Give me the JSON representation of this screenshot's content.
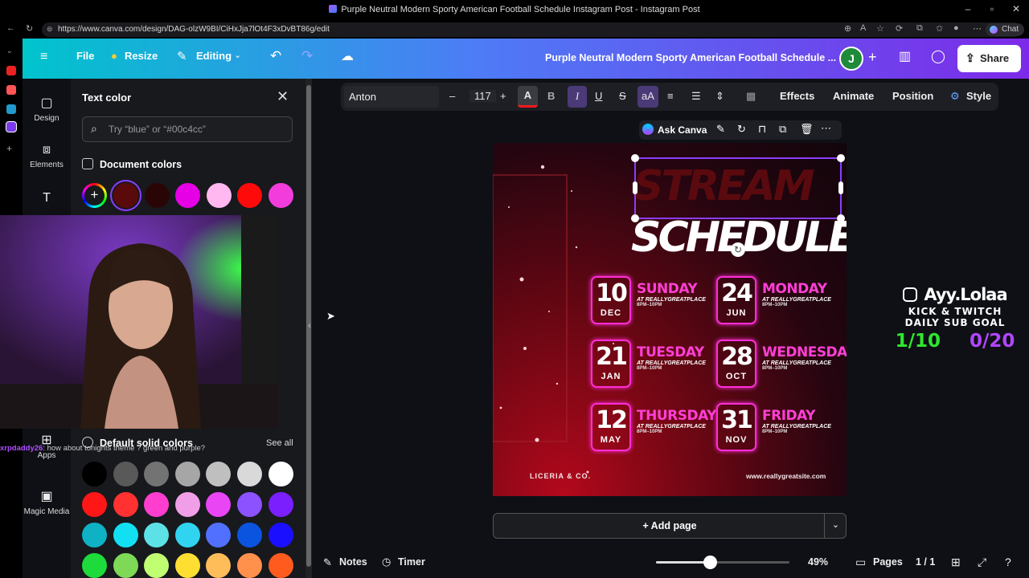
{
  "browser": {
    "window_title": "Purple Neutral Modern Sporty American Football Schedule Instagram Post - Instagram Post",
    "url": "https://www.canva.com/design/DAG-olzW9BI/CiHxJja7lOt4F3xDvBT86g/edit",
    "chat_label": "Chat"
  },
  "header": {
    "file": "File",
    "resize": "Resize",
    "editing": "Editing",
    "doc_title": "Purple Neutral Modern Sporty American Football Schedule ...",
    "avatar_initial": "J",
    "share": "Share"
  },
  "rail": {
    "design": "Design",
    "elements": "Elements",
    "apps": "Apps",
    "magic_media": "Magic Media"
  },
  "panel": {
    "title": "Text color",
    "search_placeholder": "Try “blue” or “#00c4cc”",
    "document_colors": "Document colors",
    "default_solid": "Default solid colors",
    "see_all": "See all",
    "doc_swatches": [
      "#5a0a0a",
      "#2a0505",
      "#e600e6",
      "#ffb8f0",
      "#ff0a0a",
      "#f23ddc"
    ],
    "default_swatches": [
      [
        "#000000",
        "#595959",
        "#737373",
        "#a6a6a6",
        "#bfbfbf",
        "#d9d9d9",
        "#ffffff"
      ],
      [
        "#ff1616",
        "#ff3131",
        "#ff3ecf",
        "#f19ee8",
        "#e945f5",
        "#8c52ff",
        "#7b1fff"
      ],
      [
        "#0fb1c5",
        "#12e0f2",
        "#5ce1e6",
        "#30d3f0",
        "#5170ff",
        "#0b54e0",
        "#1a10ff"
      ],
      [
        "#1ddb3b",
        "#7ed957",
        "#c1ff72",
        "#ffde32",
        "#ffbd59",
        "#ff914d",
        "#ff5b1f"
      ]
    ]
  },
  "chat": {
    "user": "xrpdaddy26",
    "message": ": how about tonights theme ? green and purple?"
  },
  "toolbar": {
    "font": "Anton",
    "minus": "–",
    "size": "117",
    "plus": "+",
    "effects": "Effects",
    "animate": "Animate",
    "position": "Position",
    "style": "Style",
    "ask_canva": "Ask Canva"
  },
  "design": {
    "stream": "STREAM",
    "schedule": "SCHEDULE",
    "items": [
      {
        "num": "10",
        "mon": "DEC",
        "day": "SUNDAY",
        "sub": "AT REALLYGREATPLACE",
        "time": "8PM–10PM"
      },
      {
        "num": "24",
        "mon": "JUN",
        "day": "MONDAY",
        "sub": "AT REALLYGREATPLACE",
        "time": "8PM–10PM"
      },
      {
        "num": "21",
        "mon": "JAN",
        "day": "TUESDAY",
        "sub": "AT REALLYGREATPLACE",
        "time": "8PM–10PM"
      },
      {
        "num": "28",
        "mon": "OCT",
        "day": "WEDNESDAY",
        "sub": "AT REALLYGREATPLACE",
        "time": "8PM–10PM"
      },
      {
        "num": "12",
        "mon": "MAY",
        "day": "THURSDAY",
        "sub": "AT REALLYGREATPLACE",
        "time": "8PM–10PM"
      },
      {
        "num": "31",
        "mon": "NOV",
        "day": "FRIDAY",
        "sub": "AT REALLYGREATPLACE",
        "time": "8PM–10PM"
      }
    ],
    "brand": "LICERIA & CO.",
    "site": "www.reallygreatsite.com"
  },
  "workspace": {
    "add_page": "+ Add page"
  },
  "bottom": {
    "notes": "Notes",
    "timer": "Timer",
    "zoom": "49%",
    "zoom_level": 0.49,
    "pages": "Pages",
    "page_count": "1 / 1"
  },
  "overlay": {
    "handle": "Ayy.Lolaa",
    "line1": "KICK & TWITCH",
    "line2": "DAILY SUB GOAL",
    "goal1": "1/10",
    "goal2": "0/20",
    "goal1_color": "#2ee62e",
    "goal2_color": "#b146ff"
  }
}
